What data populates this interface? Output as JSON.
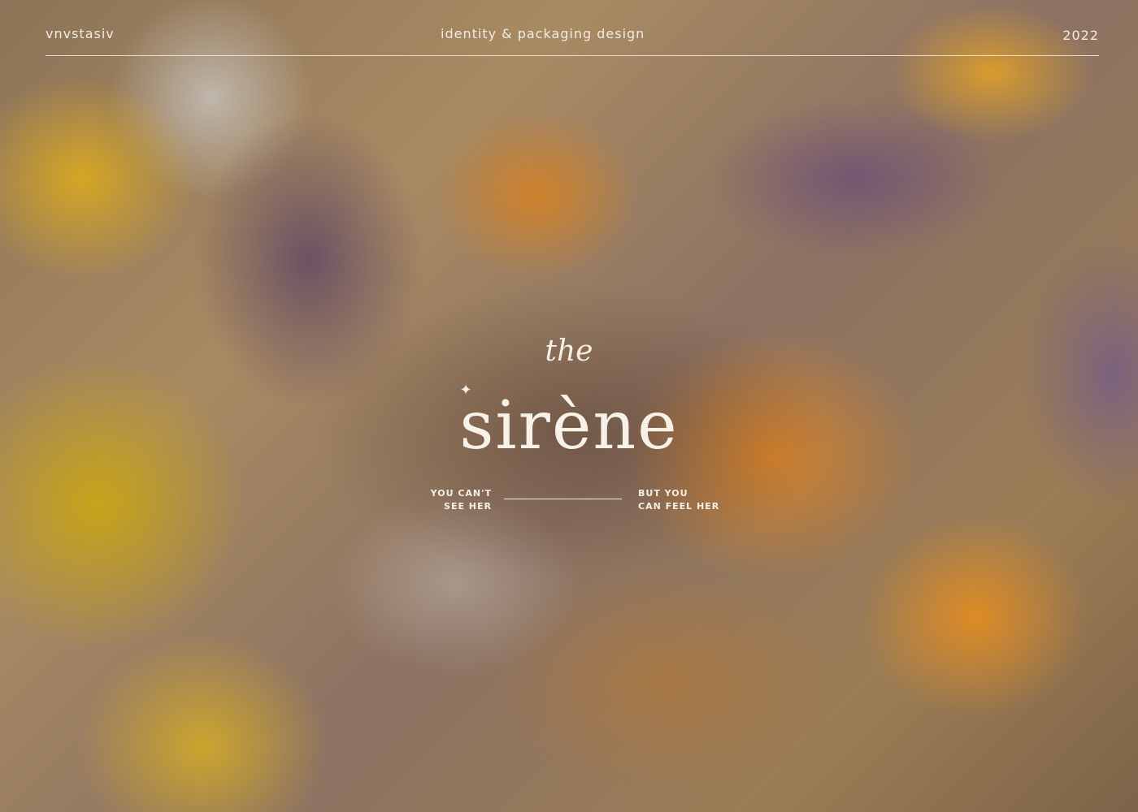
{
  "header": {
    "author": "vnvstasiv",
    "project_type": "identity & packaging design",
    "year": "2022"
  },
  "logo": {
    "article": "the",
    "brand": "sirène",
    "sparkle_icon": "four-point-star"
  },
  "tagline": {
    "left_line1": "YOU CAN'T",
    "left_line2": "SEE HER",
    "right_line1": "BUT YOU",
    "right_line2": "CAN FEEL HER"
  },
  "colors": {
    "text": "#f5efe6",
    "accent_orange": "#d6822a",
    "accent_yellow": "#c8a514",
    "accent_purple": "#735573"
  }
}
